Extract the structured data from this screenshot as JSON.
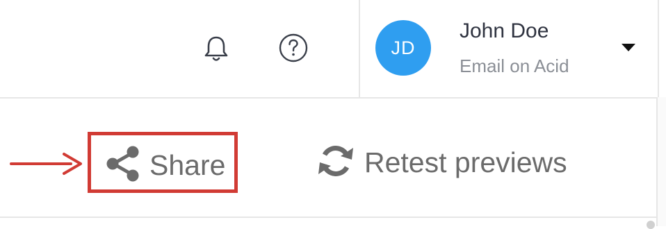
{
  "header": {
    "notifications_icon": "bell-icon",
    "help_icon": "question-circle-icon",
    "user": {
      "initials": "JD",
      "name": "John Doe",
      "organization": "Email on Acid",
      "avatar_color": "#2f9ef0",
      "menu_icon": "caret-down-icon"
    }
  },
  "toolbar": {
    "share": {
      "label": "Share",
      "icon": "share-icon",
      "highlighted": true,
      "highlight_color": "#d13b34"
    },
    "retest": {
      "label": "Retest previews",
      "icon": "refresh-icon"
    }
  },
  "annotation": {
    "arrow_icon": "arrow-right-icon",
    "arrow_color": "#d13b34"
  },
  "colors": {
    "icon_gray": "#6b6b6b",
    "text_dark": "#2f3340",
    "text_muted": "#8b8f96",
    "divider": "#e6e6e6"
  }
}
